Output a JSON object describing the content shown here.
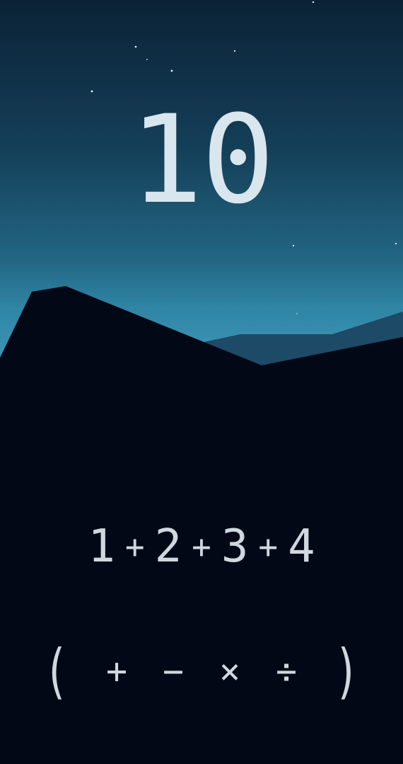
{
  "target": "10",
  "expression": {
    "tokens": [
      {
        "type": "number",
        "value": "1"
      },
      {
        "type": "operator",
        "value": "+"
      },
      {
        "type": "number",
        "value": "2"
      },
      {
        "type": "operator",
        "value": "+"
      },
      {
        "type": "number",
        "value": "3"
      },
      {
        "type": "operator",
        "value": "+"
      },
      {
        "type": "number",
        "value": "4"
      }
    ]
  },
  "operators": {
    "open_paren": "(",
    "plus": "+",
    "minus": "−",
    "times": "×",
    "divide": "÷",
    "close_paren": ")"
  },
  "colors": {
    "sky_top": "#0b2236",
    "sky_bottom": "#3b93b2",
    "far_mountain": "#1c4a66",
    "near_mountain": "#020816",
    "text": "#cfd8df"
  }
}
